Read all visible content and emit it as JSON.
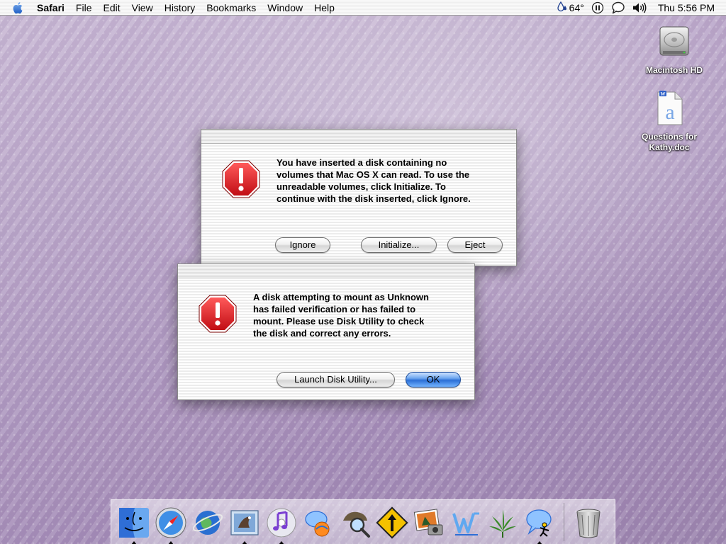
{
  "menubar": {
    "app": "Safari",
    "items": [
      "File",
      "Edit",
      "View",
      "History",
      "Bookmarks",
      "Window",
      "Help"
    ],
    "weather": "64°",
    "clock": "Thu 5:56 PM"
  },
  "desktop": {
    "hd_label": "Macintosh HD",
    "doc_label": "Questions for\nKathy.doc"
  },
  "dialog1": {
    "message_lines": [
      "You have inserted a disk containing no",
      "volumes that Mac OS X can read.  To use the",
      "unreadable volumes, click Initialize.  To",
      "continue with the disk inserted, click Ignore."
    ],
    "ignore": "Ignore",
    "initialize": "Initialize...",
    "eject": "Eject"
  },
  "dialog2": {
    "message_lines": [
      "A disk attempting to mount as Unknown",
      "has failed verification or has failed to",
      "mount.  Please use Disk Utility to check",
      "the disk and correct any errors."
    ],
    "launch": "Launch Disk Utility...",
    "ok": "OK"
  },
  "dock": {
    "icons": [
      "finder-icon",
      "safari-icon",
      "internet-explorer-icon",
      "mail-icon",
      "itunes-icon",
      "ichat-icon",
      "sherlock-icon",
      "network-utility-icon",
      "iphoto-icon",
      "word-icon",
      "cannabis-leaf-icon",
      "ichat-aim-icon",
      "trash-icon"
    ]
  },
  "colors": {
    "stop_red": "#d8141c",
    "default_button_blue": "#2b6fd6"
  }
}
